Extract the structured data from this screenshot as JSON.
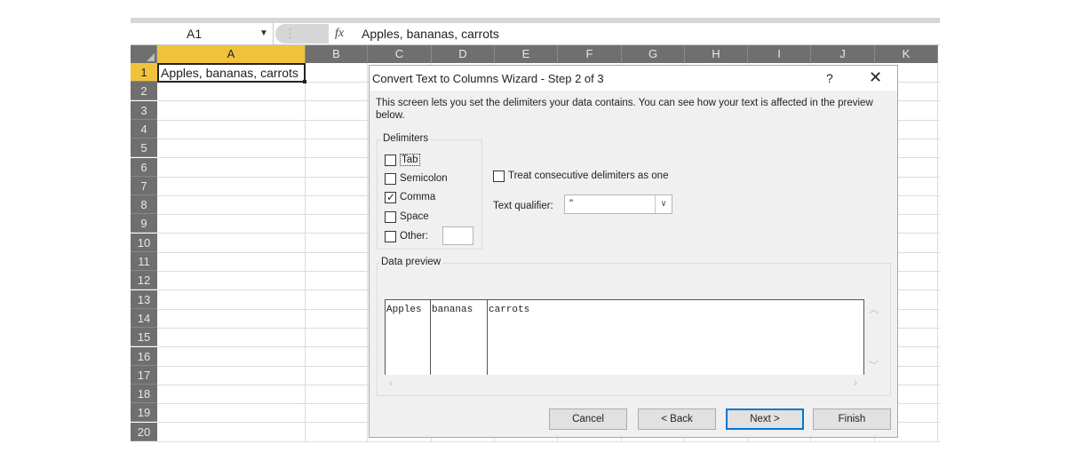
{
  "formula_bar": {
    "name_box": "A1",
    "fx_label": "fx",
    "content": "Apples, bananas, carrots"
  },
  "columns": [
    "A",
    "B",
    "C",
    "D",
    "E",
    "F",
    "G",
    "H",
    "I",
    "J",
    "K"
  ],
  "rows": [
    "1",
    "2",
    "3",
    "4",
    "5",
    "6",
    "7",
    "8",
    "9",
    "10",
    "11",
    "12",
    "13",
    "14",
    "15",
    "16",
    "17",
    "18",
    "19",
    "20"
  ],
  "cell_a1": "Apples, bananas, carrots",
  "dialog": {
    "title": "Convert Text to Columns Wizard - Step 2 of 3",
    "help": "?",
    "close": "✕",
    "description": "This screen lets you set the delimiters your data contains.  You can see how your text is affected in the preview below.",
    "delimiters_label": "Delimiters",
    "delimiters": [
      {
        "label": "Tab",
        "checked": false
      },
      {
        "label": "Semicolon",
        "checked": false
      },
      {
        "label": "Comma",
        "checked": true
      },
      {
        "label": "Space",
        "checked": false
      },
      {
        "label": "Other:",
        "checked": false
      }
    ],
    "consecutive_label": "Treat consecutive delimiters as one",
    "consecutive_checked": false,
    "text_qualifier_label": "Text qualifier:",
    "text_qualifier_value": "\"",
    "preview_label": "Data preview",
    "preview_columns": [
      "Apples",
      "bananas",
      "carrots"
    ],
    "buttons": {
      "cancel": "Cancel",
      "back": "< Back",
      "next": "Next >",
      "finish": "Finish"
    }
  }
}
